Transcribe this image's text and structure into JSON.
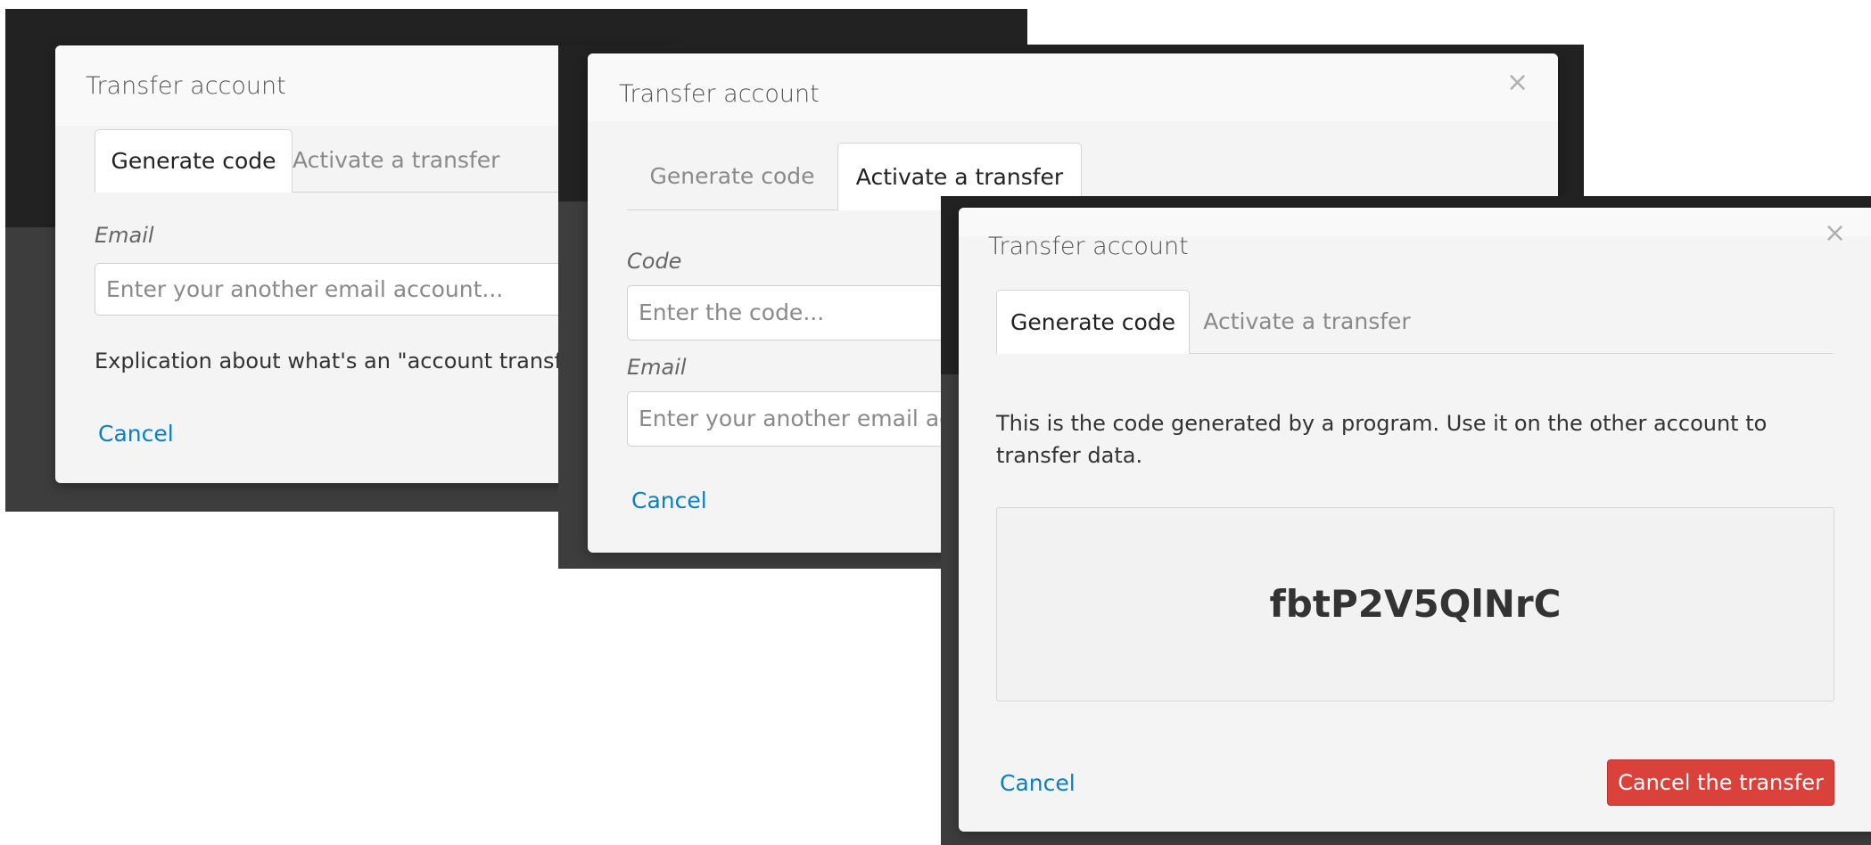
{
  "dialog1": {
    "title": "Transfer account",
    "tabs": [
      {
        "label": "Generate code",
        "active": true
      },
      {
        "label": "Activate a transfer",
        "active": false
      }
    ],
    "email_label": "Email",
    "email_placeholder": "Enter your another email account...",
    "explanation": "Explication about what's an \"account transfer\"",
    "cancel_label": "Cancel"
  },
  "dialog2": {
    "title": "Transfer account",
    "close": "×",
    "tabs": [
      {
        "label": "Generate code",
        "active": false
      },
      {
        "label": "Activate a transfer",
        "active": true
      }
    ],
    "code_label": "Code",
    "code_placeholder": "Enter the code...",
    "email_label": "Email",
    "email_placeholder": "Enter your another email account...",
    "cancel_label": "Cancel"
  },
  "dialog3": {
    "title": "Transfer account",
    "close": "×",
    "tabs": [
      {
        "label": "Generate code",
        "active": true
      },
      {
        "label": "Activate a transfer",
        "active": false
      }
    ],
    "message": "This is the code generated by a program. Use it on the other account to transfer data.",
    "code": "fbtP2V5QlNrC",
    "cancel_label": "Cancel",
    "cancel_transfer_label": "Cancel the transfer"
  },
  "colors": {
    "link": "#0a7fc4",
    "danger": "#d9413a",
    "backdrop": "#2b2b2b"
  }
}
